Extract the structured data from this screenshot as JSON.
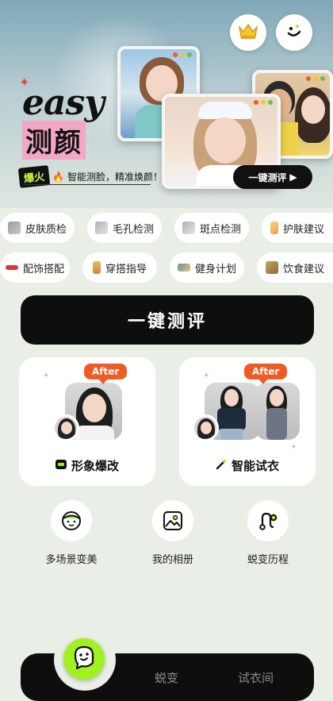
{
  "banner": {
    "logo_en": "easy",
    "logo_cn": "测颜",
    "hot_badge": "爆火",
    "tagline": "智能测脸，精准焕颜！",
    "eval_button": "一键测评"
  },
  "header_icons": [
    "crown-icon",
    "smiley-face-icon"
  ],
  "chips": {
    "row1": [
      {
        "label": "皮肤质检",
        "icon": "skin-check-icon"
      },
      {
        "label": "毛孔检测",
        "icon": "pore-detect-icon"
      },
      {
        "label": "斑点检测",
        "icon": "spot-detect-icon"
      },
      {
        "label": "护肤建议",
        "icon": "skincare-advice-icon"
      }
    ],
    "row2": [
      {
        "label": "配饰搭配",
        "icon": "accessory-icon"
      },
      {
        "label": "穿搭指导",
        "icon": "outfit-guide-icon"
      },
      {
        "label": "健身计划",
        "icon": "fitness-plan-icon"
      },
      {
        "label": "饮食建议",
        "icon": "diet-advice-icon"
      }
    ]
  },
  "cta": {
    "label": "一键测评"
  },
  "cards": [
    {
      "after_tag": "After",
      "title": "形象爆改",
      "icon": "image-makeover-icon"
    },
    {
      "after_tag": "After",
      "title": "智能试衣",
      "icon": "magic-wand-icon"
    }
  ],
  "quick_links": [
    {
      "label": "多场景变美",
      "icon": "face-icon"
    },
    {
      "label": "我的相册",
      "icon": "photo-album-icon"
    },
    {
      "label": "蜕变历程",
      "icon": "journey-path-icon"
    }
  ],
  "bottom_nav": {
    "home_icon": "ghost-face-icon",
    "tabs": [
      "蜕变",
      "试衣间"
    ]
  },
  "colors": {
    "accent_green": "#9ff21f",
    "accent_orange": "#f15a24",
    "accent_pink": "#f4a7c5",
    "dark": "#0e0e0e",
    "background": "#e9eee6"
  }
}
